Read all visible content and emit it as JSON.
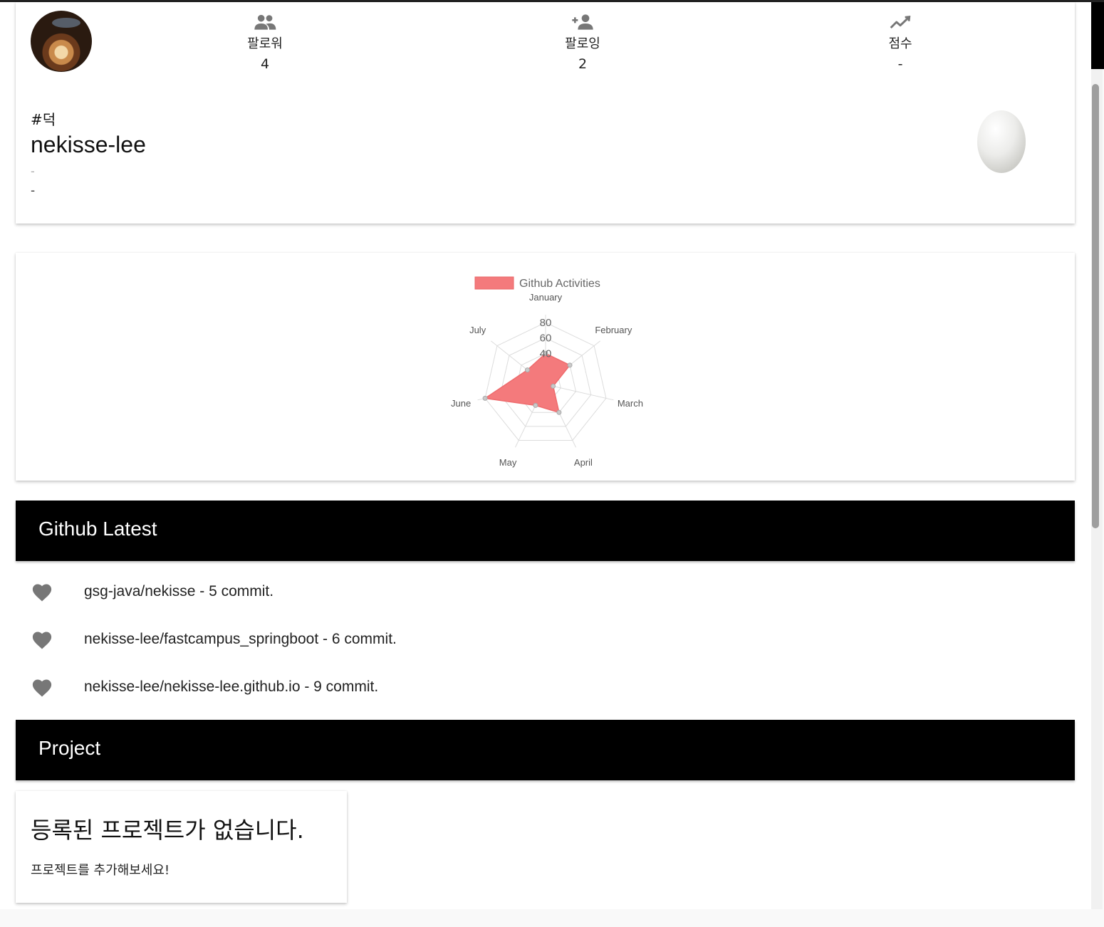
{
  "profile": {
    "stats": [
      {
        "label": "팔로워",
        "value": "4",
        "icon": "followers-icon"
      },
      {
        "label": "팔로잉",
        "value": "2",
        "icon": "add-person-icon"
      },
      {
        "label": "점수",
        "value": "-",
        "icon": "trend-icon"
      }
    ],
    "tag": "#덕",
    "username": "nekisse-lee",
    "line1": "-",
    "line2": "-"
  },
  "chart_data": {
    "type": "radar",
    "legend": "Github Activities",
    "categories": [
      "January",
      "February",
      "March",
      "April",
      "May",
      "June",
      "July"
    ],
    "values": [
      40,
      40,
      10,
      40,
      30,
      80,
      30
    ],
    "rticks": [
      "40",
      "60",
      "80"
    ],
    "rlim": [
      0,
      90
    ],
    "fill_color": "#f47a7c",
    "legend_placement": "top"
  },
  "github_latest": {
    "heading": "Github Latest",
    "items": [
      {
        "text": "gsg-java/nekisse - 5 commit."
      },
      {
        "text": "nekisse-lee/fastcampus_springboot - 6 commit."
      },
      {
        "text": "nekisse-lee/nekisse-lee.github.io - 9 commit."
      }
    ]
  },
  "project": {
    "heading": "Project",
    "empty_title": "등록된 프로젝트가 없습니다.",
    "empty_desc": "프로젝트를 추가해보세요!"
  }
}
